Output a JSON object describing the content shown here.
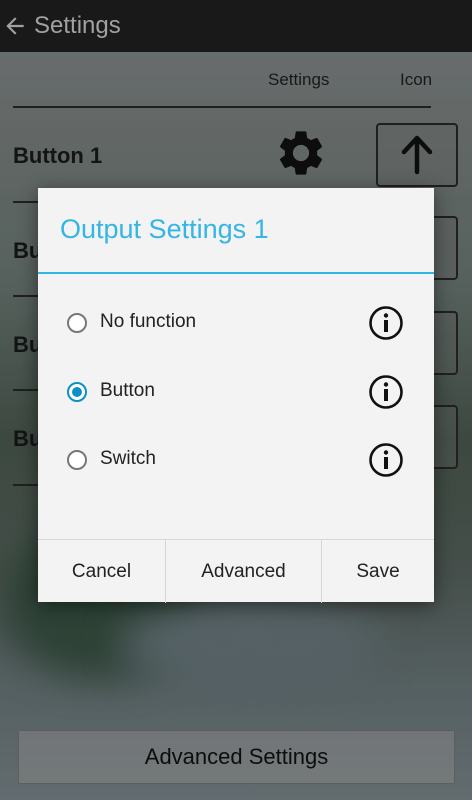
{
  "app": {
    "title": "Settings"
  },
  "table": {
    "col_settings": "Settings",
    "col_icon": "Icon",
    "rows": [
      {
        "label": "Button 1"
      },
      {
        "label": "Bu"
      },
      {
        "label": "Bu"
      },
      {
        "label": "Bu"
      }
    ]
  },
  "footer": {
    "advanced_settings_label": "Advanced Settings"
  },
  "dialog": {
    "title": "Output Settings 1",
    "options": [
      {
        "label": "No function",
        "selected": false
      },
      {
        "label": "Button",
        "selected": true
      },
      {
        "label": "Switch",
        "selected": false
      }
    ],
    "buttons": {
      "cancel": "Cancel",
      "advanced": "Advanced",
      "save": "Save"
    }
  },
  "colors": {
    "accent": "#33b5e5",
    "radio_selected": "#0e8fc5",
    "toolbar": "#202020"
  }
}
